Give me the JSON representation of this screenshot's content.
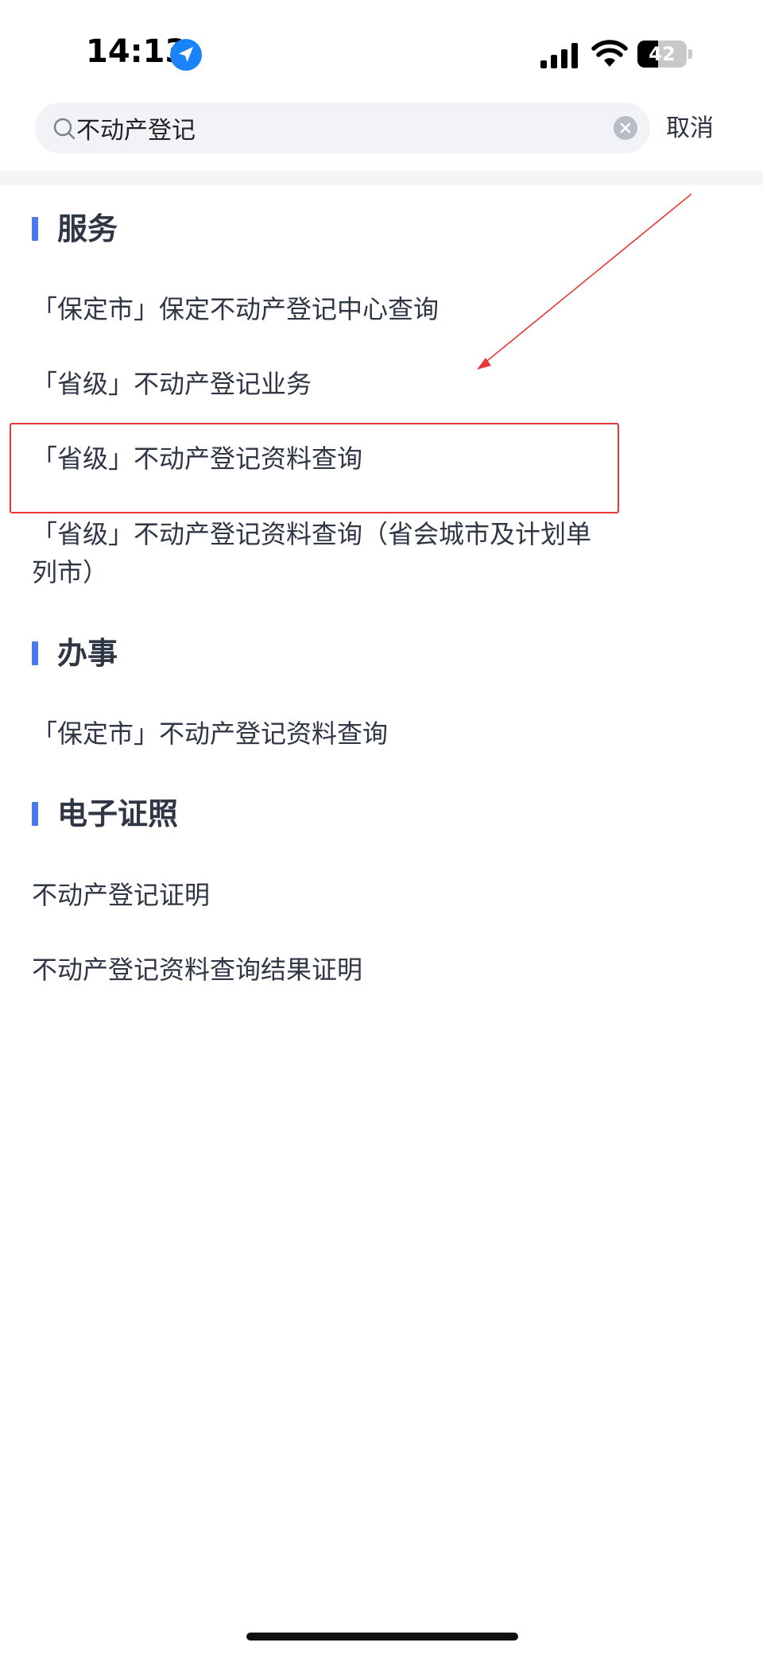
{
  "status_bar": {
    "time": "14:13",
    "battery_level": "42",
    "battery_fraction": 0.42
  },
  "search": {
    "value": "不动产登记",
    "cancel_label": "取消"
  },
  "sections": {
    "service": {
      "title": "服务",
      "items": [
        "「保定市」保定不动产登记中心查询",
        "「省级」不动产登记业务",
        "「省级」不动产登记资料查询",
        "「省级」不动产登记资料查询（省会城市及计划单列市）"
      ]
    },
    "affairs": {
      "title": "办事",
      "items": [
        "「保定市」不动产登记资料查询"
      ]
    },
    "license": {
      "title": "电子证照",
      "items": [
        "不动产登记证明",
        "不动产登记资料查询结果证明"
      ]
    }
  },
  "annotation": {
    "color": "#e53935",
    "highlighted_item": "「省级」不动产登记资料查询"
  },
  "colors": {
    "accent": "#4a78e8",
    "text": "#2f3644",
    "search_bg": "#f1f3f7",
    "location_blue": "#1a82fb"
  }
}
